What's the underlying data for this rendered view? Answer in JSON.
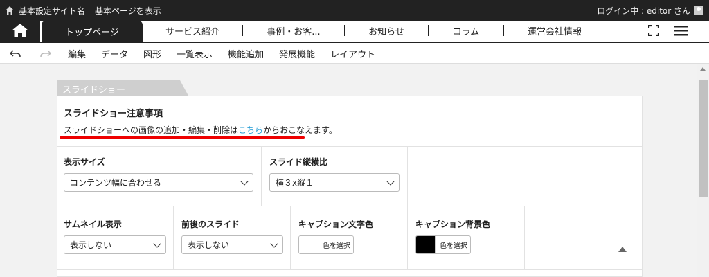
{
  "admin_bar": {
    "site_name": "基本設定サイト名",
    "page_title": "基本ページを表示",
    "login_status": "ログイン中 : editor さん"
  },
  "nav": {
    "active_tab": "トップページ",
    "items": [
      "サービス紹介",
      "事例・お客...",
      "お知らせ",
      "コラム",
      "運営会社情報"
    ]
  },
  "toolbar": {
    "items": [
      "編集",
      "データ",
      "図形",
      "一覧表示",
      "機能追加",
      "発展機能",
      "レイアウト"
    ]
  },
  "section": {
    "tab_label": "スライドショー",
    "notice_title": "スライドショー注意事項",
    "notice_text_before": "スライドショーへの画像の追加・編集・削除は",
    "notice_link": "こちら",
    "notice_text_after": "からおこなえます。"
  },
  "fields": {
    "display_size": {
      "label": "表示サイズ",
      "value": "コンテンツ幅に合わせる"
    },
    "aspect_ratio": {
      "label": "スライド縦横比",
      "value": "横３x縦１"
    },
    "thumbnail": {
      "label": "サムネイル表示",
      "value": "表示しない"
    },
    "prev_next": {
      "label": "前後のスライド",
      "value": "表示しない"
    },
    "caption_text_color": {
      "label": "キャプション文字色",
      "button": "色を選択",
      "color": "#ffffff"
    },
    "caption_bg_color": {
      "label": "キャプション背景色",
      "button": "色を選択",
      "color": "#000000"
    }
  },
  "colors": {
    "dark": "#222222",
    "link": "#2a9fd6",
    "highlight": "#e00000"
  }
}
